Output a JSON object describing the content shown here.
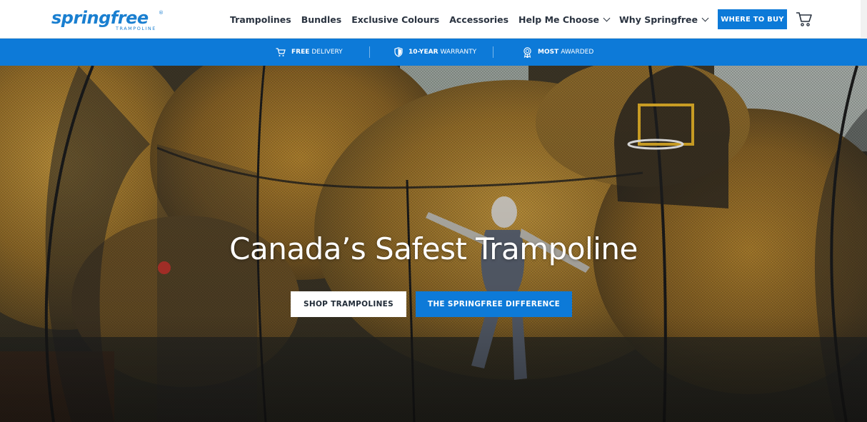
{
  "brand": {
    "name": "springfree",
    "tagline": "TRAMPOLINE",
    "registered": "®",
    "color": "#1a7fd0"
  },
  "nav": {
    "items": [
      {
        "label": "Trampolines",
        "dropdown": false
      },
      {
        "label": "Bundles",
        "dropdown": false
      },
      {
        "label": "Exclusive Colours",
        "dropdown": false
      },
      {
        "label": "Accessories",
        "dropdown": false
      },
      {
        "label": "Help Me Choose",
        "dropdown": true
      },
      {
        "label": "Why Springfree",
        "dropdown": true
      }
    ],
    "where_to_buy": "WHERE TO BUY",
    "cart_icon": "shopping-cart-icon"
  },
  "benefits": [
    {
      "icon": "cart-icon",
      "strong": "FREE",
      "text": "DELIVERY"
    },
    {
      "icon": "shield-icon",
      "strong": "10-YEAR",
      "text": "WARRANTY"
    },
    {
      "icon": "award-ribbon-icon",
      "strong": "MOST",
      "text": "AWARDED"
    }
  ],
  "hero": {
    "title": "Canada’s Safest Trampoline",
    "primary_button": "SHOP TRAMPOLINES",
    "secondary_button": "THE SPRINGFREE DIFFERENCE",
    "net_brand": "springfree"
  },
  "colors": {
    "accent": "#0d7ad8",
    "text_dark": "#2a3340",
    "white": "#ffffff"
  }
}
